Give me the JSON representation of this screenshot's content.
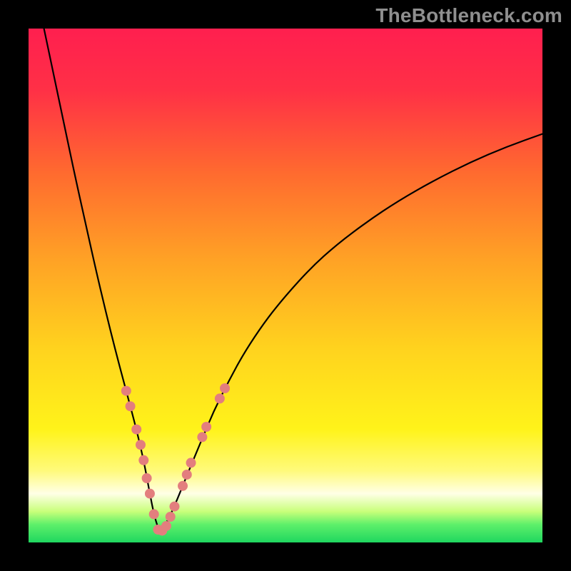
{
  "watermark": "TheBottleneck.com",
  "colors": {
    "gradient_stops": [
      {
        "offset": 0.0,
        "color": "#ff1f4f"
      },
      {
        "offset": 0.12,
        "color": "#ff3046"
      },
      {
        "offset": 0.28,
        "color": "#ff6a2f"
      },
      {
        "offset": 0.45,
        "color": "#ffa225"
      },
      {
        "offset": 0.62,
        "color": "#ffd21e"
      },
      {
        "offset": 0.78,
        "color": "#fff31a"
      },
      {
        "offset": 0.86,
        "color": "#fffa7a"
      },
      {
        "offset": 0.905,
        "color": "#ffffe6"
      },
      {
        "offset": 0.94,
        "color": "#c8ff7a"
      },
      {
        "offset": 0.965,
        "color": "#5ef06a"
      },
      {
        "offset": 1.0,
        "color": "#1fd75f"
      }
    ],
    "marker": "#e37e7e",
    "curve": "#000000"
  },
  "chart_data": {
    "type": "line",
    "title": "",
    "xlabel": "",
    "ylabel": "",
    "xlim": [
      0,
      100
    ],
    "ylim": [
      0,
      100
    ],
    "series": [
      {
        "name": "left-curve",
        "x": [
          3,
          5,
          7,
          9,
          11,
          13,
          15,
          17,
          19,
          21,
          22.5,
          23.5,
          24.5,
          25.5
        ],
        "y": [
          100,
          90.5,
          81,
          71.5,
          62.5,
          53.5,
          45,
          37,
          29.5,
          22,
          15.5,
          10,
          5,
          2
        ]
      },
      {
        "name": "right-curve",
        "x": [
          25.5,
          27,
          29,
          31,
          33.5,
          36,
          39,
          42,
          46,
          50,
          55,
          60,
          66,
          72,
          79,
          86,
          93,
          100
        ],
        "y": [
          2,
          4,
          8.5,
          13.5,
          19.5,
          25.5,
          31.5,
          37,
          43,
          48,
          53.5,
          58,
          62.5,
          66.5,
          70.5,
          74,
          77,
          79.5
        ]
      }
    ],
    "markers": [
      {
        "series": "left-curve",
        "x": 19.0,
        "y": 29.5,
        "r": 7
      },
      {
        "series": "left-curve",
        "x": 19.8,
        "y": 26.5,
        "r": 7
      },
      {
        "series": "left-curve",
        "x": 21.0,
        "y": 22.0,
        "r": 7
      },
      {
        "series": "left-curve",
        "x": 21.8,
        "y": 19.0,
        "r": 7
      },
      {
        "series": "left-curve",
        "x": 22.4,
        "y": 16.0,
        "r": 7
      },
      {
        "series": "left-curve",
        "x": 23.0,
        "y": 12.5,
        "r": 7
      },
      {
        "series": "left-curve",
        "x": 23.6,
        "y": 9.5,
        "r": 7
      },
      {
        "series": "left-curve",
        "x": 24.4,
        "y": 5.5,
        "r": 7
      },
      {
        "series": "left-curve",
        "x": 25.2,
        "y": 2.5,
        "r": 7
      },
      {
        "series": "right-curve",
        "x": 26.0,
        "y": 2.3,
        "r": 7
      },
      {
        "series": "right-curve",
        "x": 26.8,
        "y": 3.2,
        "r": 7
      },
      {
        "series": "right-curve",
        "x": 27.6,
        "y": 5.0,
        "r": 7
      },
      {
        "series": "right-curve",
        "x": 28.4,
        "y": 7.0,
        "r": 7
      },
      {
        "series": "right-curve",
        "x": 30.0,
        "y": 11.0,
        "r": 7
      },
      {
        "series": "right-curve",
        "x": 30.8,
        "y": 13.2,
        "r": 7
      },
      {
        "series": "right-curve",
        "x": 31.6,
        "y": 15.5,
        "r": 7
      },
      {
        "series": "right-curve",
        "x": 33.8,
        "y": 20.5,
        "r": 7
      },
      {
        "series": "right-curve",
        "x": 34.6,
        "y": 22.5,
        "r": 7
      },
      {
        "series": "right-curve",
        "x": 37.2,
        "y": 28.0,
        "r": 7
      },
      {
        "series": "right-curve",
        "x": 38.2,
        "y": 30.0,
        "r": 7
      }
    ],
    "legend": null,
    "grid": false
  }
}
